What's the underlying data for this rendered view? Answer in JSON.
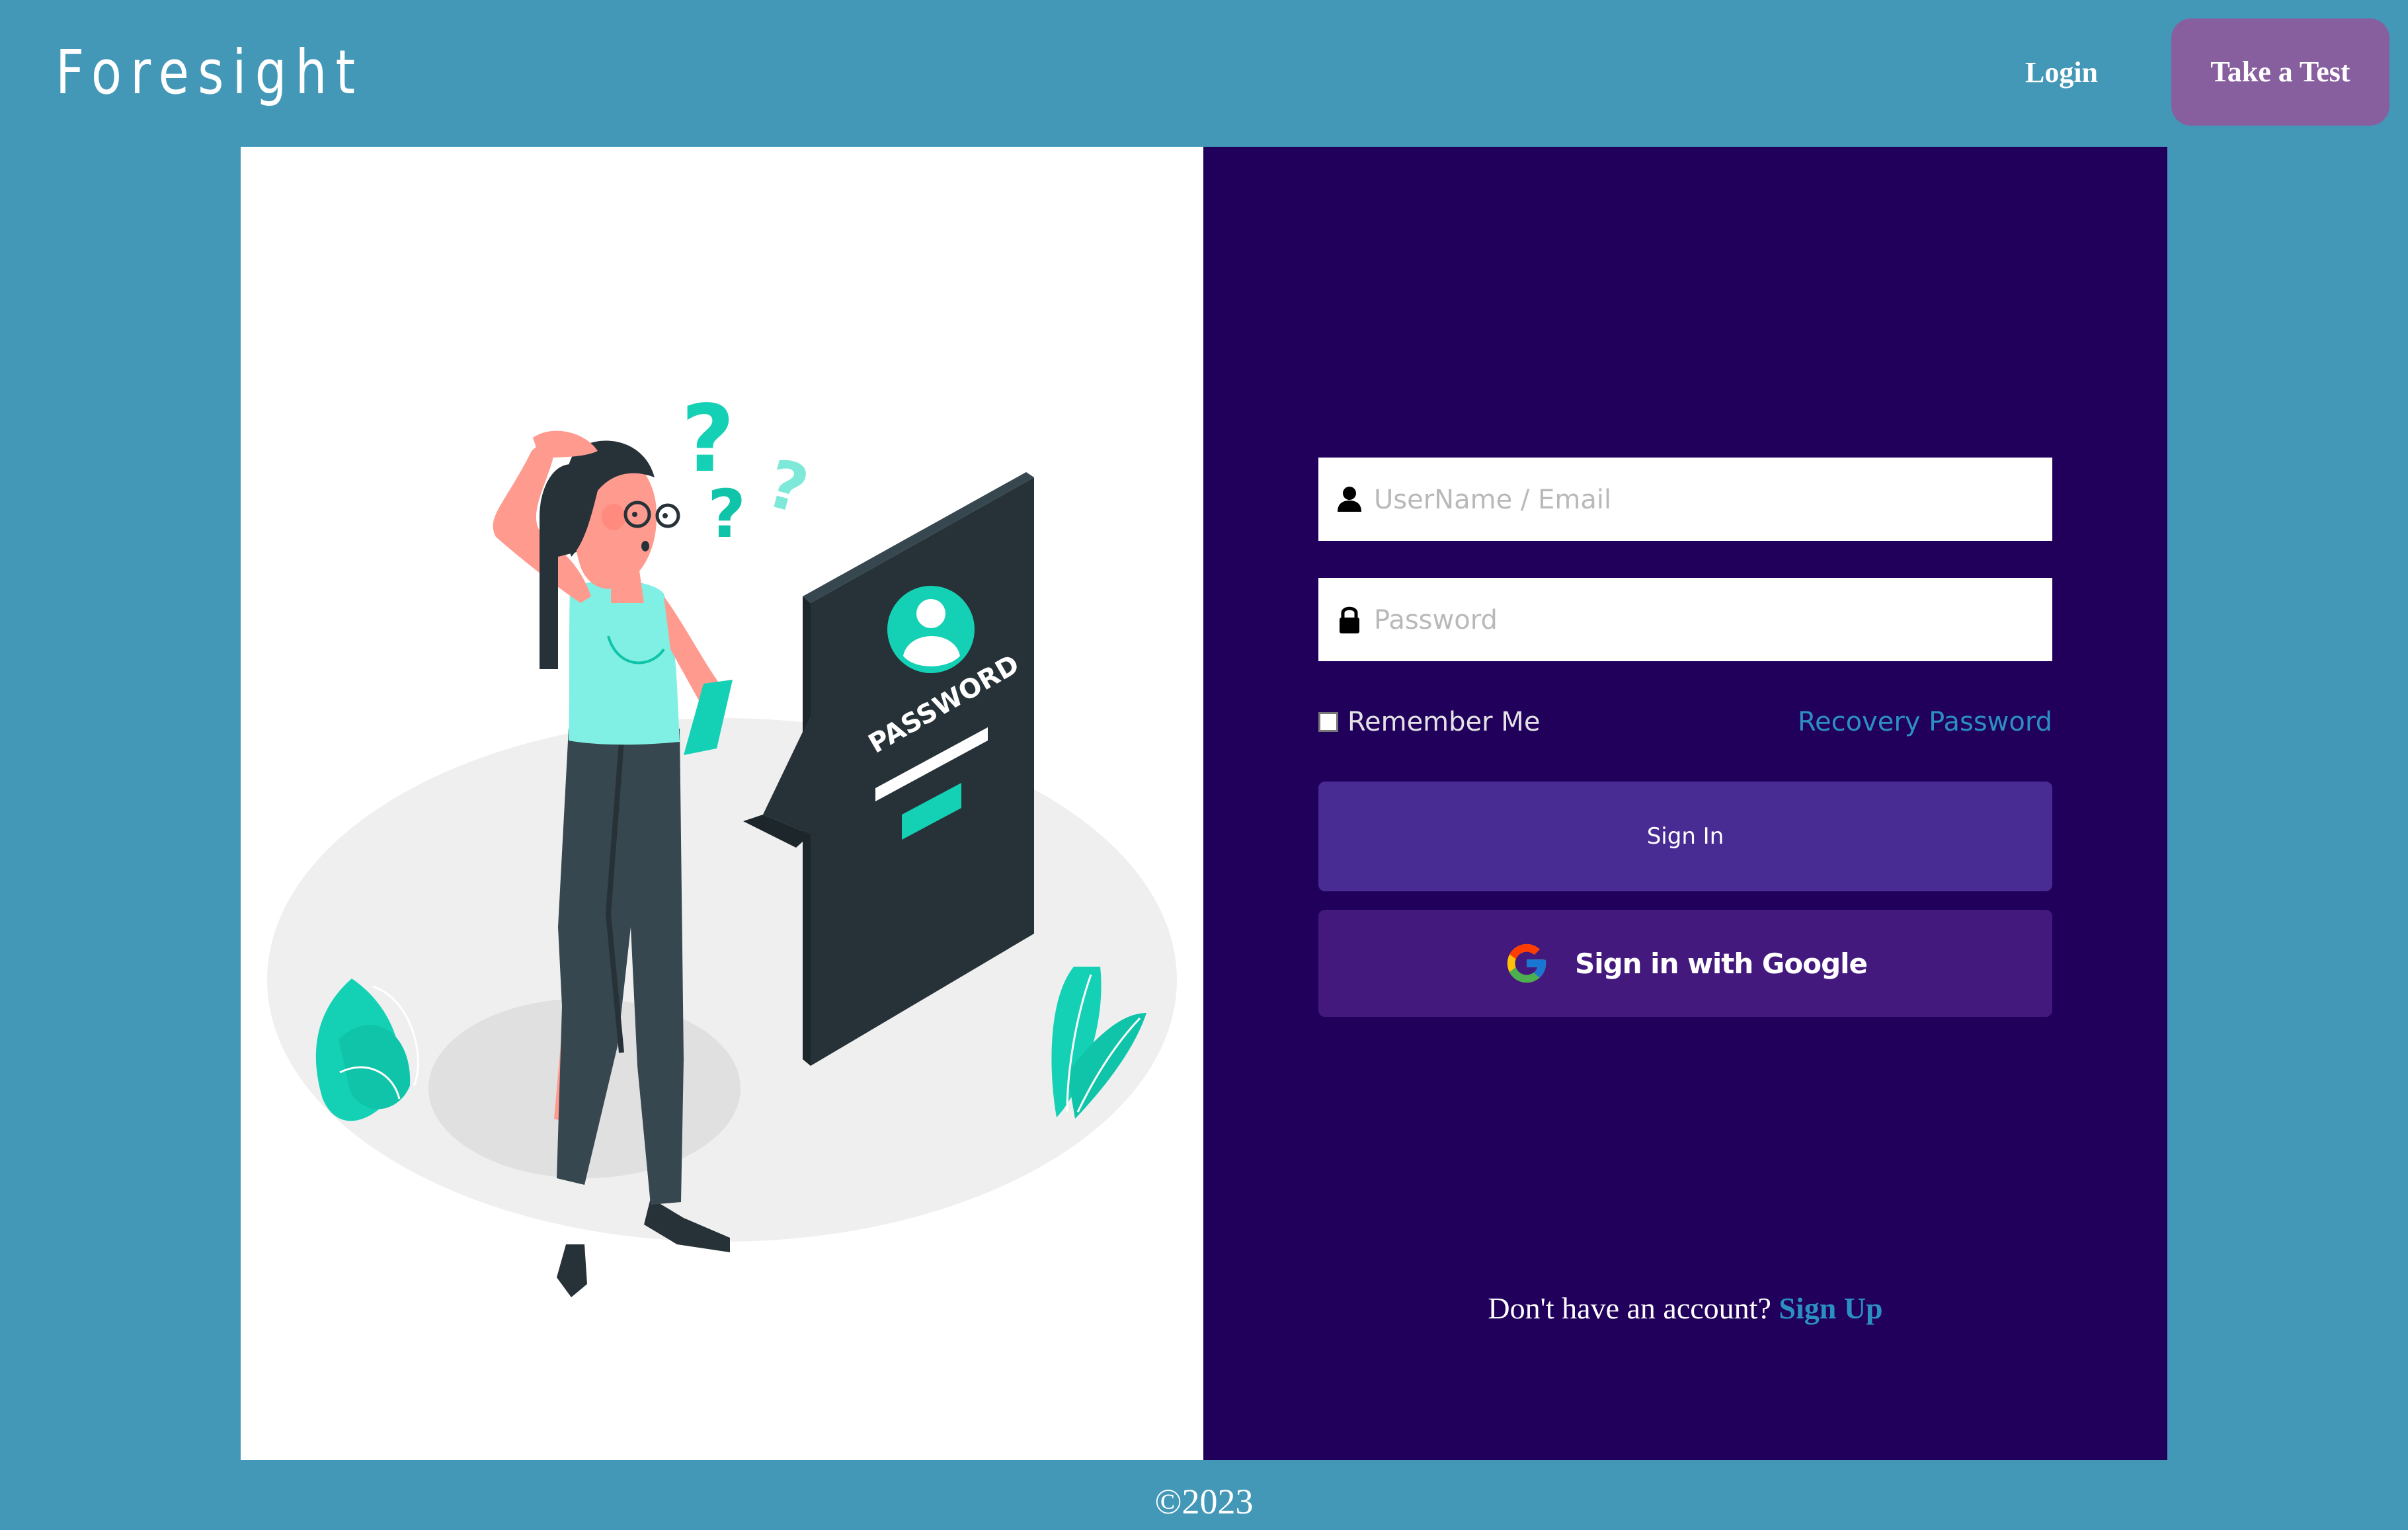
{
  "header": {
    "brand": "Foresight",
    "nav": {
      "login_label": "Login",
      "take_test_label": "Take a Test"
    }
  },
  "illustration": {
    "password_label": "PASSWORD",
    "question_mark": "?"
  },
  "form": {
    "username": {
      "placeholder": "UserName / Email",
      "value": "",
      "icon": "user-icon"
    },
    "password": {
      "placeholder": "Password",
      "value": "",
      "icon": "lock-icon"
    },
    "remember_label": "Remember Me",
    "remember_checked": false,
    "recovery_label": "Recovery Password",
    "signin_label": "Sign In",
    "google_label": "Sign in with Google",
    "signup_prompt": "Don't have an account?",
    "signup_label": "Sign Up"
  },
  "footer": {
    "text": "©2023"
  },
  "colors": {
    "page_bg": "#4398b7",
    "panel_bg": "#21005c",
    "accent_button": "#875e9e",
    "signin_button": "#482c93",
    "google_button": "#44197e",
    "link": "#2c8fc2",
    "illustration_teal": "#14d1b5"
  }
}
